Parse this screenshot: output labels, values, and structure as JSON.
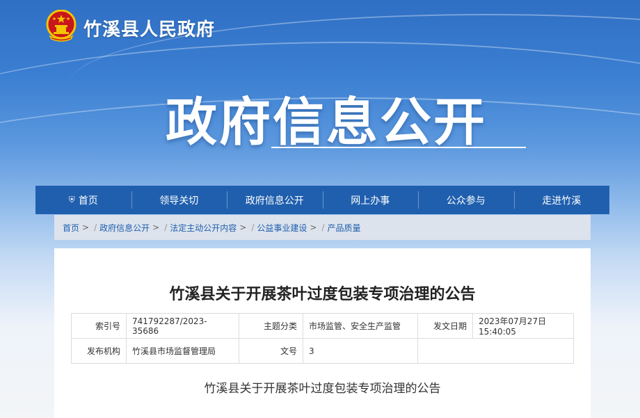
{
  "header": {
    "site_name": "竹溪县人民政府",
    "hero_title": "政府信息公开"
  },
  "nav": {
    "items": [
      "首页",
      "领导关切",
      "政府信息公开",
      "网上办事",
      "公众参与",
      "走进竹溪"
    ]
  },
  "breadcrumb": {
    "items": [
      "首页",
      "政府信息公开",
      "法定主动公开内容",
      "公益事业建设",
      "产品质量"
    ],
    "separator": ">"
  },
  "article": {
    "title": "竹溪县关于开展茶叶过度包装专项治理的公告",
    "meta": {
      "index_label": "索引号",
      "index_value": "741792287/2023-35686",
      "topic_label": "主题分类",
      "topic_value": "市场监管、安全生产监管",
      "date_label": "发文日期",
      "date_value": "2023年07月27日 15:40:05",
      "org_label": "发布机构",
      "org_value": "竹溪县市场监督管理局",
      "docno_label": "文号",
      "docno_value": "3"
    },
    "body_title": "竹溪县关于开展茶叶过度包装专项治理的公告"
  },
  "colors": {
    "nav_bg": "#1f5fae",
    "link": "#1f5fae",
    "emblem_red": "#c8161d",
    "emblem_gold": "#f5c400"
  },
  "icons": {
    "home": "home-icon",
    "emblem": "national-emblem-icon"
  }
}
